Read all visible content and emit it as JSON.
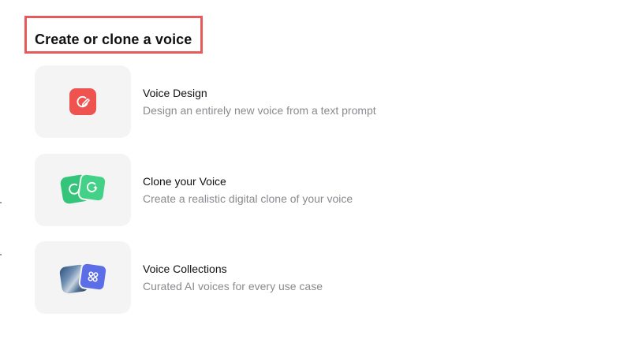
{
  "section": {
    "title": "Create or clone a voice"
  },
  "options": [
    {
      "label": "Voice Design",
      "description": "Design an entirely new voice from a text prompt",
      "icon": "voice-design-icon",
      "color": "#ef5350"
    },
    {
      "label": "Clone your Voice",
      "description": "Create a realistic digital clone of your voice",
      "icon": "clone-voice-icon",
      "color": "#3ecb7f"
    },
    {
      "label": "Voice Collections",
      "description": "Curated AI voices for every use case",
      "icon": "voice-collections-icon",
      "color": "#5b6ee8"
    }
  ],
  "colors": {
    "highlight_border": "#e35b5b",
    "tile_background": "#f4f4f5",
    "description_text": "#8a8a8f"
  }
}
